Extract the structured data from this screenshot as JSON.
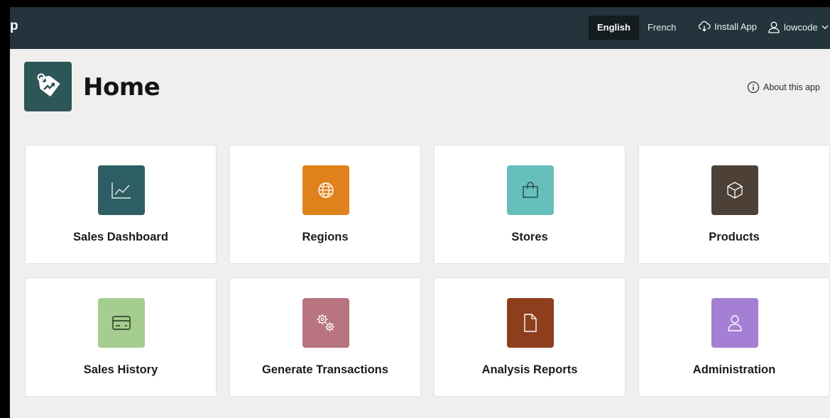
{
  "topbar": {
    "brand": "p",
    "languages": [
      {
        "label": "English",
        "active": true
      },
      {
        "label": "French",
        "active": false
      }
    ],
    "install_label": "Install App",
    "user_label": "lowcode"
  },
  "header": {
    "title": "Home",
    "about_label": "About this app"
  },
  "cards": [
    {
      "label": "Sales Dashboard",
      "icon": "line-chart-icon",
      "color": "#2d5e63"
    },
    {
      "label": "Regions",
      "icon": "globe-icon",
      "color": "#e0821b"
    },
    {
      "label": "Stores",
      "icon": "shopping-bag-icon",
      "color": "#67bfbb"
    },
    {
      "label": "Products",
      "icon": "box-icon",
      "color": "#4d4036"
    },
    {
      "label": "Sales History",
      "icon": "credit-card-icon",
      "color": "#a5cd8f"
    },
    {
      "label": "Generate Transactions",
      "icon": "gears-icon",
      "color": "#b8747f"
    },
    {
      "label": "Analysis Reports",
      "icon": "document-icon",
      "color": "#8e3e1c"
    },
    {
      "label": "Administration",
      "icon": "user-icon",
      "color": "#a47fd3"
    }
  ],
  "colors": {
    "topbar": "#23343c",
    "background": "#f1efed",
    "app_icon": "#2d5659"
  }
}
